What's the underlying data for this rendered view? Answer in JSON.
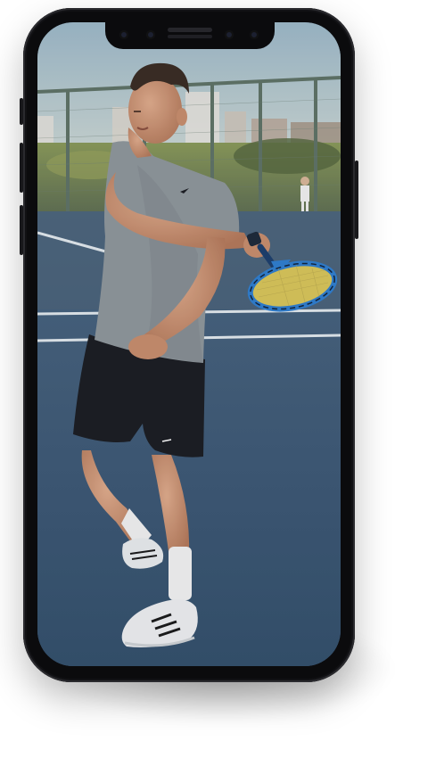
{
  "device": {
    "type": "phone",
    "frame_color": "#0b0b0d"
  },
  "screen": {
    "content": "photo",
    "colors": {
      "sky": "#a9c3cf",
      "court": "#3e5a76",
      "court_lines": "#e8eef2",
      "fence": "#6b7f74",
      "shirt": "#8f979c",
      "shorts": "#1b1d22",
      "racket": "#2f7fd0",
      "racket_strings": "#d9c65a"
    }
  }
}
